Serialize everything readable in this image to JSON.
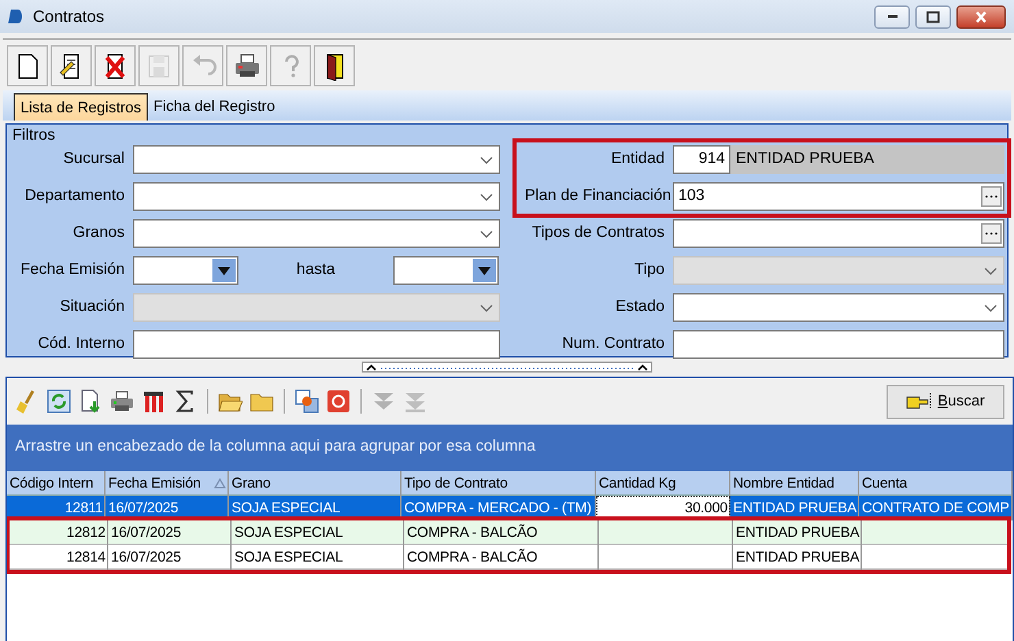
{
  "window": {
    "title": "Contratos"
  },
  "toolbar": [
    {
      "kind": "new",
      "disabled": false
    },
    {
      "kind": "edit",
      "disabled": false
    },
    {
      "kind": "delete",
      "disabled": false
    },
    {
      "kind": "save",
      "disabled": true
    },
    {
      "kind": "undo",
      "disabled": true
    },
    {
      "kind": "print",
      "disabled": false
    },
    {
      "kind": "help",
      "disabled": true
    },
    {
      "kind": "exit",
      "disabled": false
    }
  ],
  "tabs": [
    {
      "label": "Lista de Registros",
      "selected": true
    },
    {
      "label": "Ficha del Registro",
      "selected": false
    }
  ],
  "filters": {
    "title": "Filtros",
    "left": [
      {
        "label": "Sucursal",
        "kind": "combo",
        "disabled": false
      },
      {
        "label": "Departamento",
        "kind": "combo",
        "disabled": false
      },
      {
        "label": "Granos",
        "kind": "combo",
        "disabled": false
      },
      {
        "label": "Fecha Emisión",
        "kind": "daterange",
        "to_label": "hasta"
      },
      {
        "label": "Situación",
        "kind": "combo",
        "disabled": true
      },
      {
        "label": "Cód. Interno",
        "kind": "text"
      }
    ],
    "right": [
      {
        "label": "Entidad",
        "kind": "entity",
        "code": "914",
        "value": "ENTIDAD PRUEBA",
        "highlighted": true
      },
      {
        "label": "Plan de Financiación",
        "kind": "lookup",
        "value": "103",
        "highlighted": true
      },
      {
        "label": "Tipos de Contratos",
        "kind": "lookup",
        "highlighted": false
      },
      {
        "label": "Tipo",
        "kind": "combo",
        "disabled": true,
        "highlighted": false
      },
      {
        "label": "Estado",
        "kind": "combo",
        "disabled": false,
        "highlighted": false
      },
      {
        "label": "Num. Contrato",
        "kind": "text",
        "highlighted": false
      }
    ]
  },
  "grid_toolbar": [
    {
      "kind": "clear",
      "disabled": false
    },
    {
      "kind": "refresh",
      "disabled": false
    },
    {
      "kind": "export",
      "disabled": false
    },
    {
      "kind": "print",
      "disabled": false
    },
    {
      "kind": "columns",
      "disabled": false
    },
    {
      "kind": "sum",
      "disabled": false
    },
    {
      "kind": "sep"
    },
    {
      "kind": "open",
      "disabled": false
    },
    {
      "kind": "folder",
      "disabled": false
    },
    {
      "kind": "sep"
    },
    {
      "kind": "settings",
      "disabled": false
    },
    {
      "kind": "stop",
      "disabled": false
    },
    {
      "kind": "sep"
    },
    {
      "kind": "down",
      "disabled": true
    },
    {
      "kind": "bottom",
      "disabled": true
    }
  ],
  "search_button": "Buscar",
  "group_hint": "Arrastre un encabezado de la columna aqui para agrupar por esa columna",
  "table": {
    "columns": [
      {
        "label": "Código Intern",
        "kind": "number"
      },
      {
        "label": "Fecha Emisión",
        "kind": "text",
        "sorted_ascending": true
      },
      {
        "label": "Grano",
        "kind": "text"
      },
      {
        "label": "Tipo de Contrato",
        "kind": "text"
      },
      {
        "label": "Cantidad Kg",
        "kind": "number"
      },
      {
        "label": "Nombre Entidad",
        "kind": "text"
      },
      {
        "label": "Cuenta",
        "kind": "text"
      }
    ],
    "rows": [
      {
        "selected": true,
        "highlighted": false,
        "cells": [
          "12811",
          "16/07/2025",
          "SOJA ESPECIAL",
          "COMPRA - MERCADO - (TM)",
          {
            "text": "30.000",
            "focused": true
          },
          "ENTIDAD PRUEBA",
          "CONTRATO DE COMP"
        ]
      },
      {
        "selected": false,
        "highlighted": true,
        "cells": [
          "12812",
          "16/07/2025",
          "SOJA ESPECIAL",
          "COMPRA - BALCÃO",
          "",
          "ENTIDAD PRUEBA",
          ""
        ]
      },
      {
        "selected": false,
        "highlighted": true,
        "cells": [
          "12814",
          "16/07/2025",
          "SOJA ESPECIAL",
          "COMPRA - BALCÃO",
          "",
          "ENTIDAD PRUEBA",
          ""
        ]
      }
    ]
  }
}
